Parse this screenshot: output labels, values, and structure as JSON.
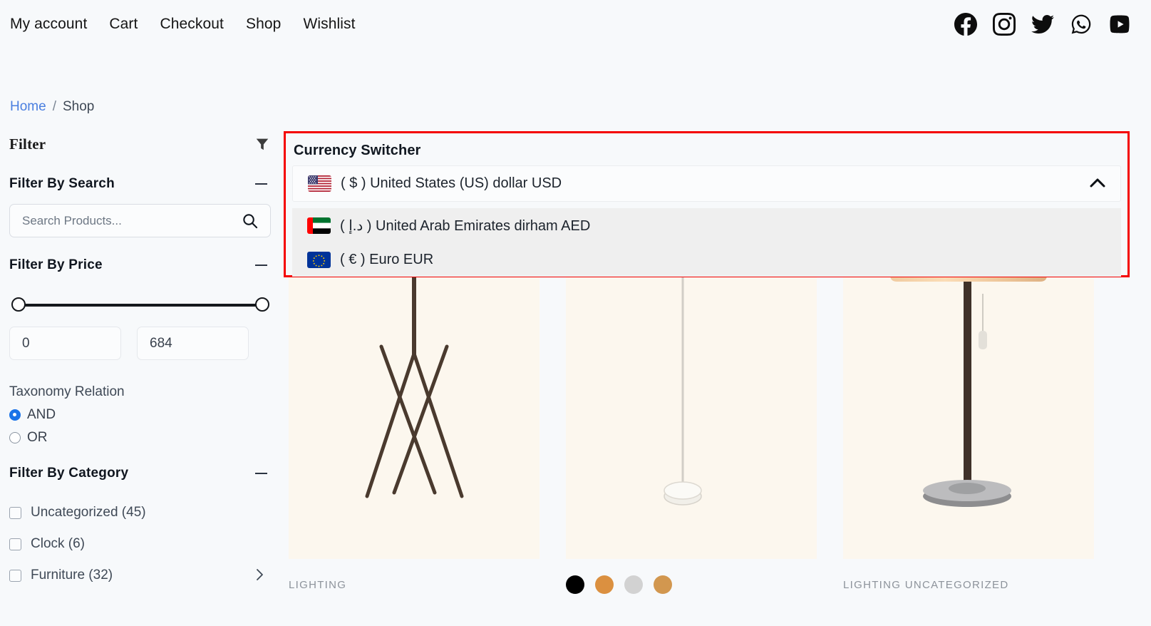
{
  "topnav": {
    "items": [
      {
        "label": "My account"
      },
      {
        "label": "Cart"
      },
      {
        "label": "Checkout"
      },
      {
        "label": "Shop"
      },
      {
        "label": "Wishlist"
      }
    ],
    "socials": [
      {
        "name": "facebook-icon"
      },
      {
        "name": "instagram-icon"
      },
      {
        "name": "twitter-icon"
      },
      {
        "name": "whatsapp-icon"
      },
      {
        "name": "youtube-icon"
      }
    ]
  },
  "breadcrumb": {
    "home": "Home",
    "separator": "/",
    "current": "Shop"
  },
  "sidebar": {
    "filter_title": "Filter",
    "filter_icon": "funnel-icon",
    "search_section": {
      "title": "Filter By Search",
      "placeholder": "Search Products...",
      "value": "",
      "search_icon": "search-icon",
      "collapse_icon": "minus-icon"
    },
    "price_section": {
      "title": "Filter By Price",
      "min_value": "0",
      "max_value": "684",
      "collapse_icon": "minus-icon"
    },
    "taxonomy": {
      "label": "Taxonomy Relation",
      "options": [
        {
          "label": "AND",
          "selected": true
        },
        {
          "label": "OR",
          "selected": false
        }
      ]
    },
    "category_section": {
      "title": "Filter By Category",
      "collapse_icon": "minus-icon",
      "items": [
        {
          "label": "Uncategorized (45)",
          "checked": false,
          "has_children": false
        },
        {
          "label": "Clock (6)",
          "checked": false,
          "has_children": false
        },
        {
          "label": "Furniture (32)",
          "checked": false,
          "has_children": true
        }
      ]
    }
  },
  "currency_switcher": {
    "title": "Currency Switcher",
    "selected": {
      "flag": "us-flag-icon",
      "label": "( $ ) United States (US) dollar USD"
    },
    "caret_icon": "chevron-up-icon",
    "options": [
      {
        "flag": "ae-flag-icon",
        "label": "( د.إ ) United Arab Emirates dirham AED"
      },
      {
        "flag": "eu-flag-icon",
        "label": "( € ) Euro EUR"
      }
    ],
    "highlight_color": "#f40000"
  },
  "products": [
    {
      "category": "LIGHTING",
      "image": "knit-shade-tripod-floor-lamp",
      "swatches": []
    },
    {
      "category": "",
      "image": "white-task-floor-lamp",
      "swatches": [
        "#000000",
        "#db9040",
        "#d2d2d2",
        "#d2974f"
      ]
    },
    {
      "category": "LIGHTING  UNCATEGORIZED",
      "image": "cone-shade-floor-lamp",
      "swatches": []
    }
  ]
}
